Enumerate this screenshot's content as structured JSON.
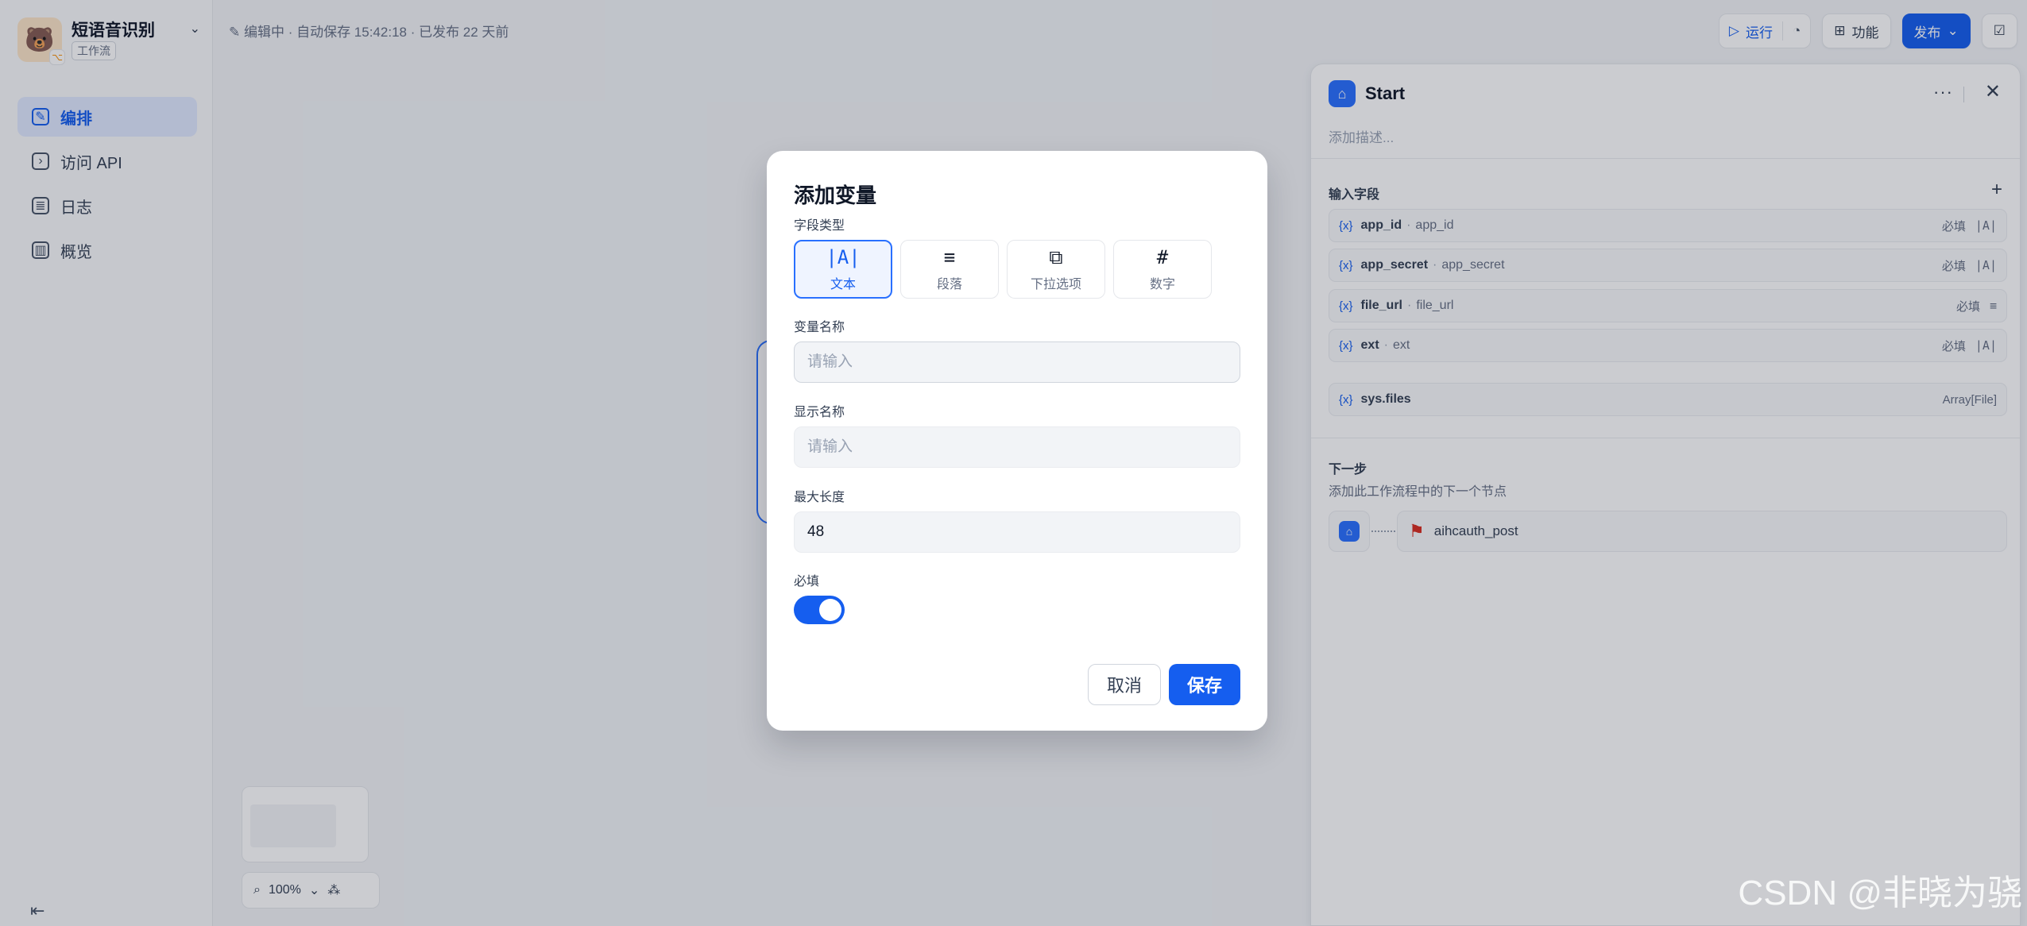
{
  "app": {
    "name": "短语音识别",
    "type": "工作流"
  },
  "nav": [
    {
      "label": "编排",
      "icon": "edit-icon",
      "active": true
    },
    {
      "label": "访问 API",
      "icon": "terminal-icon",
      "active": false
    },
    {
      "label": "日志",
      "icon": "file-log-icon",
      "active": false
    },
    {
      "label": "概览",
      "icon": "chart-icon",
      "active": false
    }
  ],
  "status": "编辑中 · 自动保存 15:42:18 · 已发布 22 天前",
  "toolbar": {
    "run_label": "运行",
    "features_label": "功能",
    "publish_label": "发布"
  },
  "zoom": "100%",
  "panel": {
    "title": "Start",
    "description_placeholder": "添加描述...",
    "input_section": "输入字段",
    "fields": [
      {
        "name": "app_id",
        "var": "app_id",
        "required": "必填",
        "type_glyph": "|A|"
      },
      {
        "name": "app_secret",
        "var": "app_secret",
        "required": "必填",
        "type_glyph": "|A|"
      },
      {
        "name": "file_url",
        "var": "file_url",
        "required": "必填",
        "type_glyph": "≡"
      },
      {
        "name": "ext",
        "var": "ext",
        "required": "必填",
        "type_glyph": "|A|"
      }
    ],
    "sys_field": {
      "name": "sys.files",
      "type": "Array[File]"
    },
    "fx_label": "{x}",
    "next_title": "下一步",
    "next_subtitle": "添加此工作流程中的下一个节点",
    "next_node": "aihcauth_post"
  },
  "modal": {
    "title": "添加变量",
    "field_type_label": "字段类型",
    "types": [
      {
        "label": "文本",
        "glyph": "|A|",
        "active": true
      },
      {
        "label": "段落",
        "glyph": "≡",
        "active": false
      },
      {
        "label": "下拉选项",
        "glyph": "⧉",
        "active": false
      },
      {
        "label": "数字",
        "glyph": "#",
        "active": false
      }
    ],
    "var_name_label": "变量名称",
    "var_name_placeholder": "请输入",
    "display_name_label": "显示名称",
    "display_name_placeholder": "请输入",
    "max_length_label": "最大长度",
    "max_length_value": "48",
    "required_label": "必填",
    "required_on": true,
    "cancel_label": "取消",
    "save_label": "保存"
  },
  "watermark": "CSDN @非晓为骁",
  "colors": {
    "accent": "#155eef",
    "node_blue": "#2970ff",
    "flag_red": "#d92d20"
  }
}
